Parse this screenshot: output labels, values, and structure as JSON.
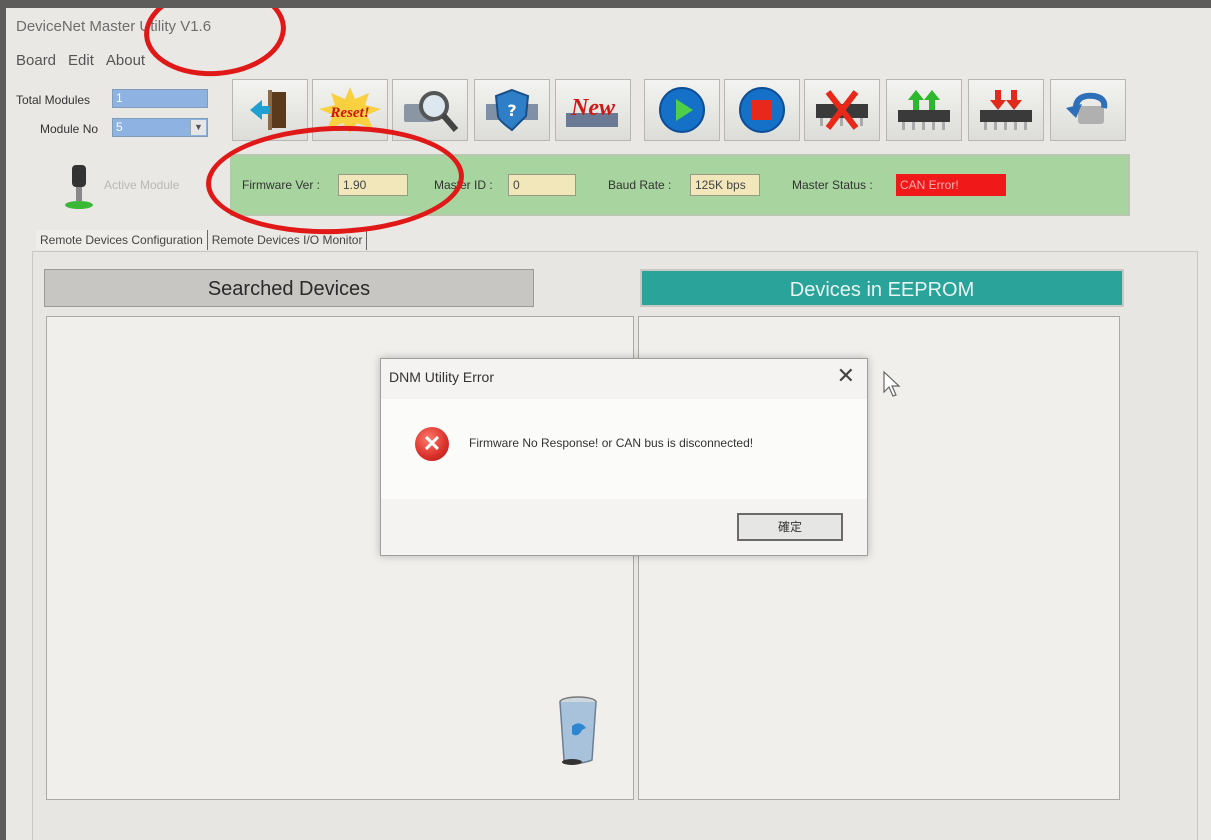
{
  "window": {
    "title": "DeviceNet Master Utility V1.6"
  },
  "menu": [
    "Board",
    "Edit",
    "About"
  ],
  "module": {
    "total_label": "Total Modules",
    "total_value": "1",
    "no_label": "Module No",
    "no_value": "5"
  },
  "toolbar": {
    "reset_label": "Reset!",
    "new_label": "New"
  },
  "active_module": {
    "label": "Active Module"
  },
  "status": {
    "firmware_label": "Firmware Ver :",
    "firmware_value": "1.90",
    "master_id_label": "Master ID :",
    "master_id_value": "0",
    "baud_label": "Baud Rate :",
    "baud_value": "125K bps",
    "master_status_label": "Master Status :",
    "master_status_value": "CAN Error!"
  },
  "tabs": [
    "Remote Devices Configuration",
    "Remote Devices I/O Monitor"
  ],
  "panes": {
    "searched_title": "Searched Devices",
    "eeprom_title": "Devices in EEPROM"
  },
  "dialog": {
    "title": "DNM Utility Error",
    "message": "Firmware No Response! or CAN bus is disconnected!",
    "ok_label": "確定"
  },
  "colors": {
    "status_panel": "#a8d4a0",
    "eeprom_header": "#2aa39a",
    "error_badge": "#f01818",
    "annotation": "#e01818"
  }
}
